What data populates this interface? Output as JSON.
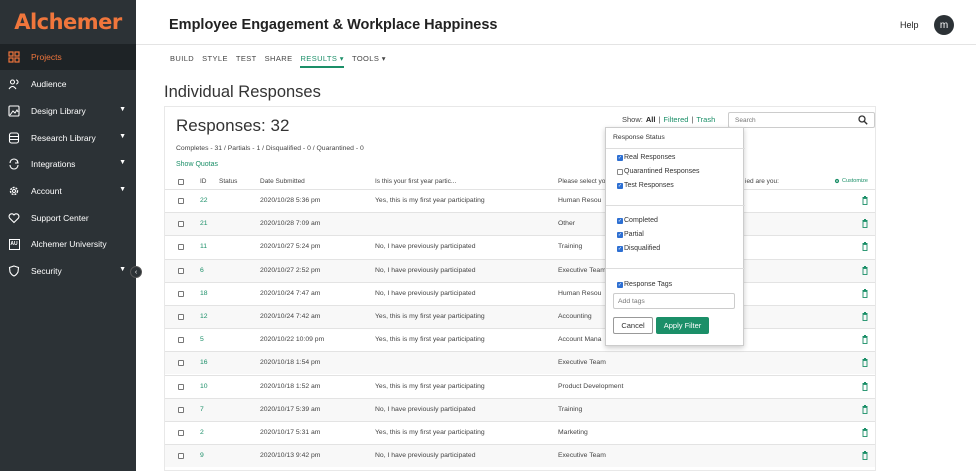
{
  "app": {
    "logo": "Alchemer"
  },
  "sidebar": {
    "items": [
      {
        "label": "Projects",
        "icon": "grid-icon",
        "caret": false
      },
      {
        "label": "Audience",
        "icon": "people-icon",
        "caret": false
      },
      {
        "label": "Design Library",
        "icon": "image-icon",
        "caret": true
      },
      {
        "label": "Research Library",
        "icon": "database-icon",
        "caret": true
      },
      {
        "label": "Integrations",
        "icon": "sync-icon",
        "caret": true
      },
      {
        "label": "Account",
        "icon": "gear-icon",
        "caret": true
      },
      {
        "label": "Support Center",
        "icon": "heart-icon",
        "caret": false
      },
      {
        "label": "Alchemer University",
        "icon": "au-icon",
        "caret": false
      },
      {
        "label": "Security",
        "icon": "shield-icon",
        "caret": true
      }
    ],
    "au_badge": "AU",
    "caret_glyph": "▼",
    "collapse_glyph": "‹"
  },
  "header": {
    "title": "Employee Engagement & Workplace Happiness",
    "help": "Help",
    "avatar": "m"
  },
  "tabs": [
    "BUILD",
    "STYLE",
    "TEST",
    "SHARE",
    "RESULTS ▾",
    "TOOLS ▾"
  ],
  "page": {
    "title": "Individual Responses",
    "responses_count": "Responses: 32",
    "summary": "Completes - 31 / Partials - 1 / Disqualified - 0 / Quarantined - 0",
    "show_quotas": "Show Quotas"
  },
  "show_filter": {
    "label": "Show:",
    "all": "All",
    "sep": "|",
    "filtered": "Filtered",
    "trash": "Trash"
  },
  "search": {
    "placeholder": "Search"
  },
  "table": {
    "columns": [
      "ID",
      "Status",
      "Date Submitted",
      "Is this your first year partic...",
      "Please select yo",
      "ied are you:"
    ],
    "customize": "Customize",
    "rows": [
      {
        "id": "22",
        "date": "2020/10/28 5:36 pm",
        "q1": "Yes, this is my first year participating",
        "q2": "Human Resou"
      },
      {
        "id": "21",
        "date": "2020/10/28 7:09 am",
        "q1": "",
        "q2": "Other"
      },
      {
        "id": "11",
        "date": "2020/10/27 5:24 pm",
        "q1": "No, I have previously participated",
        "q2": "Training"
      },
      {
        "id": "6",
        "date": "2020/10/27 2:52 pm",
        "q1": "No, I have previously participated",
        "q2": "Executive Team"
      },
      {
        "id": "18",
        "date": "2020/10/24 7:47 am",
        "q1": "No, I have previously participated",
        "q2": "Human Resou"
      },
      {
        "id": "12",
        "date": "2020/10/24 7:42 am",
        "q1": "Yes, this is my first year participating",
        "q2": "Accounting"
      },
      {
        "id": "5",
        "date": "2020/10/22 10:09 pm",
        "q1": "Yes, this is my first year participating",
        "q2": "Account Mana"
      },
      {
        "id": "16",
        "date": "2020/10/18 1:54 pm",
        "q1": "",
        "q2": "Executive Team"
      },
      {
        "id": "10",
        "date": "2020/10/18 1:52 am",
        "q1": "Yes, this is my first year participating",
        "q2": "Product Development"
      },
      {
        "id": "7",
        "date": "2020/10/17 5:39 am",
        "q1": "No, I have previously participated",
        "q2": "Training"
      },
      {
        "id": "2",
        "date": "2020/10/17 5:31 am",
        "q1": "Yes, this is my first year participating",
        "q2": "Marketing"
      },
      {
        "id": "9",
        "date": "2020/10/13 9:42 pm",
        "q1": "No, I have previously participated",
        "q2": "Executive Team"
      }
    ]
  },
  "filter_dropdown": {
    "title": "Response Status",
    "group1": [
      {
        "label": "Real Responses",
        "checked": true
      },
      {
        "label": "Quarantined Responses",
        "checked": false
      },
      {
        "label": "Test Responses",
        "checked": true
      }
    ],
    "group2": [
      {
        "label": "Completed",
        "checked": true
      },
      {
        "label": "Partial",
        "checked": true
      },
      {
        "label": "Disqualified",
        "checked": true
      }
    ],
    "tags": {
      "label": "Response Tags",
      "checked": true,
      "placeholder": "Add tags"
    },
    "cancel": "Cancel",
    "apply": "Apply Filter",
    "check_glyph": "✓"
  },
  "colors": {
    "accent": "#1b8f68",
    "sidebar": "#2c3236",
    "brand": "#f0763c",
    "checkbox": "#2d6fd2"
  }
}
